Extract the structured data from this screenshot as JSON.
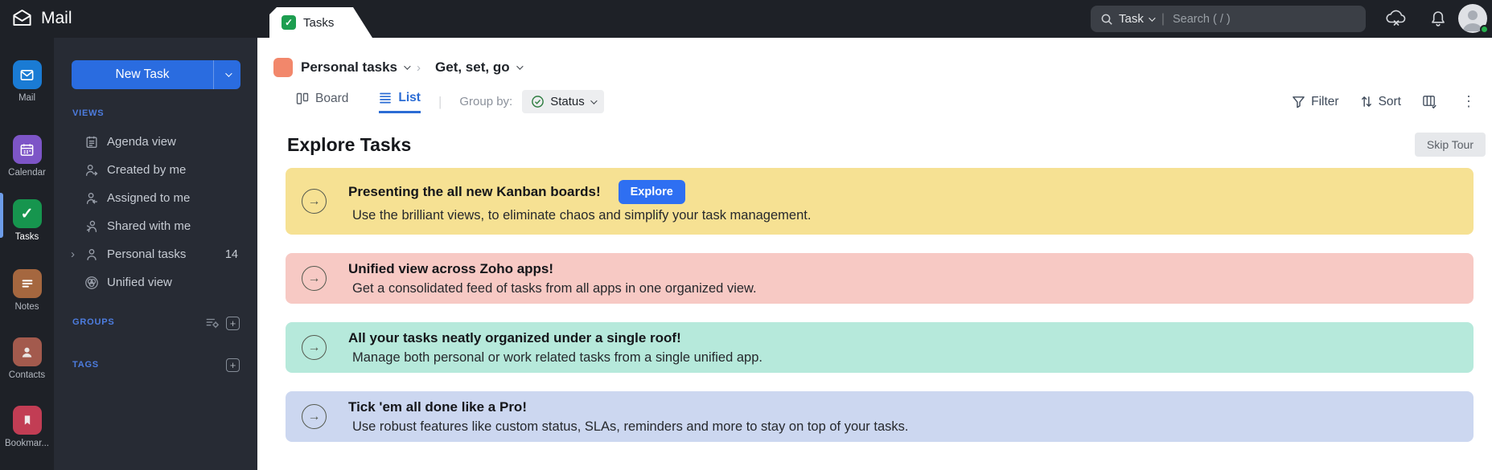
{
  "app": {
    "brand": "Mail",
    "tab": "Tasks"
  },
  "topbar": {
    "search_scope": "Task",
    "search_placeholder": "Search ( / )"
  },
  "rail": {
    "items": [
      "Mail",
      "Calendar",
      "Tasks",
      "Notes",
      "Contacts",
      "Bookmar..."
    ],
    "active_item": "Tasks"
  },
  "sidebar": {
    "new_task_label": "New Task",
    "views_label": "VIEWS",
    "views": [
      "Agenda view",
      "Created by me",
      "Assigned to me",
      "Shared with me",
      "Personal tasks",
      "Unified view"
    ],
    "personal_tasks_count": "14",
    "groups_label": "GROUPS",
    "tags_label": "TAGS"
  },
  "header": {
    "breadcrumb": {
      "list_name": "Personal tasks",
      "view_name": "Get, set, go"
    },
    "board_tab": "Board",
    "list_tab": "List",
    "group_by_label": "Group by:",
    "group_by_value": "Status",
    "filter_label": "Filter",
    "sort_label": "Sort"
  },
  "main": {
    "title": "Explore Tasks",
    "skip_tour_label": "Skip Tour",
    "banners": [
      {
        "title": "Presenting the all new Kanban boards!",
        "subtitle": "Use the brilliant views, to eliminate chaos and simplify your task management.",
        "button": "Explore",
        "bg": "#f6e193"
      },
      {
        "title": "Unified view across Zoho apps!",
        "subtitle": "Get a consolidated feed of tasks from all apps in one organized view.",
        "bg": "#f7c9c4"
      },
      {
        "title": "All your tasks neatly organized under a single roof!",
        "subtitle": "Manage both personal or work related tasks from a single unified app.",
        "bg": "#b6e9db"
      },
      {
        "title": "Tick 'em all done like a Pro!",
        "subtitle": "Use robust features like custom status, SLAs, reminders and more to stay on top of your tasks.",
        "bg": "#ccd7f0"
      }
    ]
  },
  "icons": {
    "arrow_right": "→",
    "plus": "+",
    "kebab": "⋮",
    "expander": "›",
    "tab_check": "✓",
    "rail_task_check": "✓",
    "crumb_sep": "›"
  },
  "colors": {
    "topbar_bg": "#1e2127",
    "sidebar_bg": "#272b34",
    "accent_blue": "#2a6ce0",
    "list_active_blue": "#2b6cd4",
    "status_check_green": "#2e7d40",
    "breadcrumb_swatch": "#f2876b",
    "rail_mail": "#1a7bd4",
    "rail_calendar": "#7d55c7",
    "rail_tasks": "#16954e",
    "rail_notes": "#a5673f",
    "rail_contacts": "#a35a4d",
    "rail_bookmarks": "#c23d54",
    "online_dot": "#25b14c"
  }
}
